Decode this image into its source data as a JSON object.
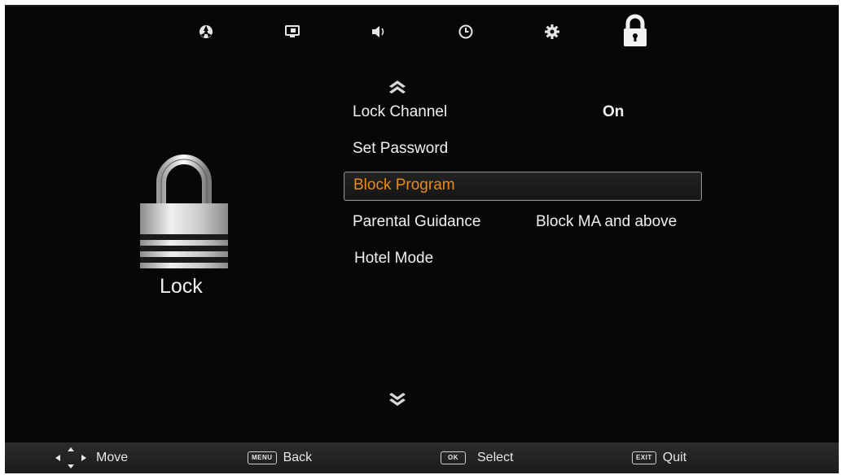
{
  "tabs": [
    {
      "name": "picture-icon"
    },
    {
      "name": "screen-icon"
    },
    {
      "name": "sound-icon"
    },
    {
      "name": "time-icon"
    },
    {
      "name": "settings-icon"
    },
    {
      "name": "lock-icon",
      "active": true
    }
  ],
  "panel": {
    "title": "Lock",
    "icon": "big-lock-icon"
  },
  "menu": {
    "items": [
      {
        "label": "Lock Channel",
        "value": "On"
      },
      {
        "label": "Set Password",
        "value": ""
      },
      {
        "label": "Block Program",
        "value": "",
        "selected": true
      },
      {
        "label": "Parental Guidance",
        "value": "Block MA and above"
      },
      {
        "label": "Hotel Mode",
        "value": ""
      }
    ]
  },
  "footer": {
    "move": {
      "label": "Move"
    },
    "back": {
      "key": "MENU",
      "label": "Back"
    },
    "select": {
      "key": "OK",
      "label": "Select"
    },
    "quit": {
      "key": "EXIT",
      "label": "Quit"
    }
  },
  "colors": {
    "background": "#070707",
    "selected_text": "#e98a1f",
    "text": "#f0f0f0"
  }
}
